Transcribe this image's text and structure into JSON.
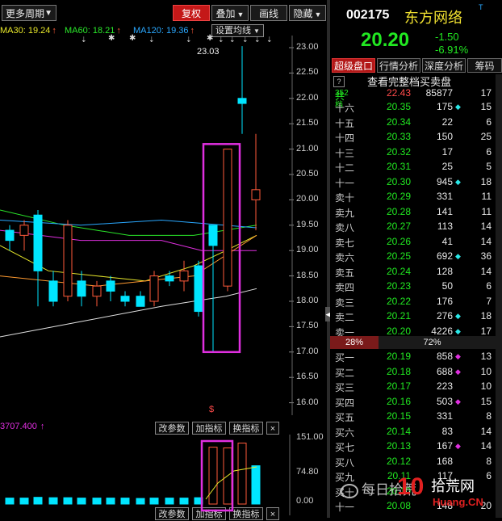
{
  "toolbar": {
    "period_label": "更多周期",
    "btn_fuquan": "复权",
    "btn_overlay": "叠加",
    "btn_draw": "画线",
    "btn_hide": "隐藏"
  },
  "ma_legend": {
    "ma30": "MA30: 19.24",
    "ma60": "MA60: 18.21",
    "ma120": "MA120: 19.36",
    "settings": "设置均线"
  },
  "colors": {
    "ma30": "#e8e82a",
    "ma60": "#2ae82a",
    "ma120": "#2aa8ff",
    "up": "#ff5a3a",
    "down": "#00e5ff",
    "highlight": "#e02fe0"
  },
  "price_axis": {
    "ticks": [
      "23.00",
      "22.50",
      "22.00",
      "21.50",
      "21.00",
      "20.50",
      "20.00",
      "19.50",
      "19.00",
      "18.50",
      "18.00",
      "17.50",
      "17.00",
      "16.50",
      "16.00"
    ],
    "max_label": "23.03"
  },
  "indicator": {
    "label": "3707.400",
    "change_params": "改参数",
    "add_indicator": "加指标",
    "switch_indicator": "换指标",
    "close": "×",
    "axis": [
      "151.00",
      "74.80",
      "0.00"
    ]
  },
  "stock": {
    "code": "002175",
    "name": "东方网络",
    "price": "20.20",
    "change": "-1.50",
    "change_pct": "-6.91%"
  },
  "tabs": [
    "超级盘口",
    "行情分析",
    "深度分析",
    "筹码"
  ],
  "panel": {
    "view_all": "查看完整档买卖盘",
    "total_label": "共",
    "total_levels": "352档",
    "total_price": "22.43",
    "total_vol": "85877",
    "total_count": "17",
    "ratio_left": "28%",
    "ratio_right": "72%"
  },
  "asks": [
    {
      "label": "十六",
      "price": "20.35",
      "vol": "175",
      "mark": "◆",
      "count": "15"
    },
    {
      "label": "十五",
      "price": "20.34",
      "vol": "22",
      "mark": "",
      "count": "6"
    },
    {
      "label": "十四",
      "price": "20.33",
      "vol": "150",
      "mark": "",
      "count": "25"
    },
    {
      "label": "十三",
      "price": "20.32",
      "vol": "17",
      "mark": "",
      "count": "6"
    },
    {
      "label": "十二",
      "price": "20.31",
      "vol": "25",
      "mark": "",
      "count": "5"
    },
    {
      "label": "十一",
      "price": "20.30",
      "vol": "945",
      "mark": "◆",
      "count": "18"
    },
    {
      "label": "卖十",
      "price": "20.29",
      "vol": "331",
      "mark": "",
      "count": "11"
    },
    {
      "label": "卖九",
      "price": "20.28",
      "vol": "141",
      "mark": "",
      "count": "11"
    },
    {
      "label": "卖八",
      "price": "20.27",
      "vol": "113",
      "mark": "",
      "count": "14"
    },
    {
      "label": "卖七",
      "price": "20.26",
      "vol": "41",
      "mark": "",
      "count": "14"
    },
    {
      "label": "卖六",
      "price": "20.25",
      "vol": "692",
      "mark": "◆",
      "count": "36"
    },
    {
      "label": "卖五",
      "price": "20.24",
      "vol": "128",
      "mark": "",
      "count": "14"
    },
    {
      "label": "卖四",
      "price": "20.23",
      "vol": "50",
      "mark": "",
      "count": "6"
    },
    {
      "label": "卖三",
      "price": "20.22",
      "vol": "176",
      "mark": "",
      "count": "7"
    },
    {
      "label": "卖二",
      "price": "20.21",
      "vol": "276",
      "mark": "◆",
      "count": "18"
    },
    {
      "label": "卖一",
      "price": "20.20",
      "vol": "4226",
      "mark": "◆",
      "count": "17"
    }
  ],
  "bids": [
    {
      "label": "买一",
      "price": "20.19",
      "vol": "858",
      "mark": "◆",
      "count": "13"
    },
    {
      "label": "买二",
      "price": "20.18",
      "vol": "688",
      "mark": "◆",
      "count": "10"
    },
    {
      "label": "买三",
      "price": "20.17",
      "vol": "223",
      "mark": "",
      "count": "10"
    },
    {
      "label": "买四",
      "price": "20.16",
      "vol": "503",
      "mark": "◆",
      "count": "15"
    },
    {
      "label": "买五",
      "price": "20.15",
      "vol": "331",
      "mark": "",
      "count": "8"
    },
    {
      "label": "买六",
      "price": "20.14",
      "vol": "83",
      "mark": "",
      "count": "14"
    },
    {
      "label": "买七",
      "price": "20.13",
      "vol": "167",
      "mark": "◆",
      "count": "14"
    },
    {
      "label": "买八",
      "price": "20.12",
      "vol": "168",
      "mark": "",
      "count": "8"
    },
    {
      "label": "买九",
      "price": "20.11",
      "vol": "117",
      "mark": "",
      "count": "6"
    },
    {
      "label": "买十",
      "price": "20.10",
      "vol": "",
      "mark": "",
      "count": ""
    },
    {
      "label": "十一",
      "price": "20.08",
      "vol": "148",
      "mark": "",
      "count": "20"
    }
  ],
  "watermark": "每日拾荒",
  "logo_text": "拾荒网",
  "logo_sub": "Huang.CN"
}
